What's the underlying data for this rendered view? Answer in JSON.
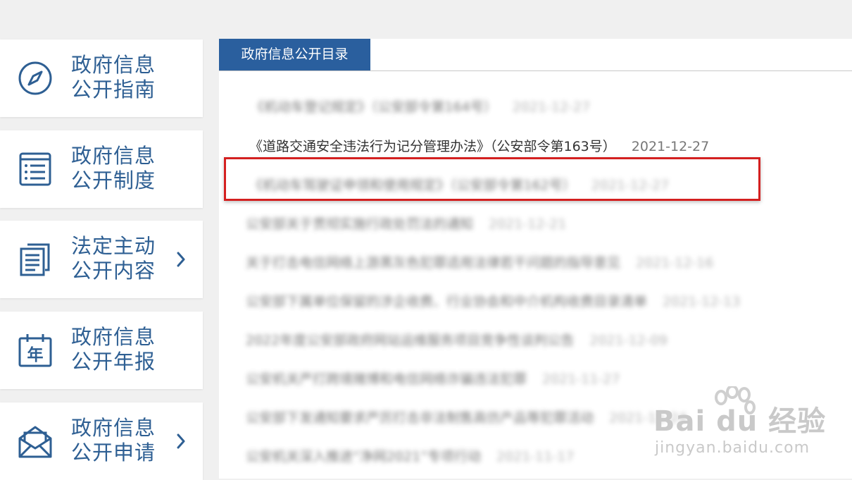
{
  "sidebar": {
    "items": [
      {
        "line1": "政府信息",
        "line2": "公开指南",
        "icon": "compass-icon",
        "has_arrow": false
      },
      {
        "line1": "政府信息",
        "line2": "公开制度",
        "icon": "list-document-icon",
        "has_arrow": false
      },
      {
        "line1": "法定主动",
        "line2": "公开内容",
        "icon": "documents-icon",
        "has_arrow": true
      },
      {
        "line1": "政府信息",
        "line2": "公开年报",
        "icon": "calendar-year-icon",
        "icon_text": "年",
        "has_arrow": false
      },
      {
        "line1": "政府信息",
        "line2": "公开申请",
        "icon": "envelope-icon",
        "has_arrow": true
      }
    ]
  },
  "main": {
    "tab_label": "政府信息公开目录",
    "items": [
      {
        "title": "《机动车登记规定》（公安部令第164号）",
        "date": "2021-12-27"
      },
      {
        "title": "《道路交通安全违法行为记分管理办法》（公安部令第163号）",
        "date": "2021-12-27"
      },
      {
        "title": "《机动车驾驶证申领和使用规定》（公安部令第162号）",
        "date": "2021-12-27"
      },
      {
        "title": "公安部关于贯彻实施行政处罚法的通知",
        "date": "2021-12-21"
      },
      {
        "title": "关于打击电信网络上游黑灰色犯罪适用法律若干问题的指导意见",
        "date": "2021-12-16"
      },
      {
        "title": "公安部下属单位保留的涉企收费、行业协会和中介机构收费目录清单",
        "date": "2021-12-13"
      },
      {
        "title": "2022年度公安部政府网站运维服务项目竞争性谈判公告",
        "date": "2021-12-09"
      },
      {
        "title": "公安机关严打跨境赌博和电信网络诈骗违法犯罪",
        "date": "2021-11-27"
      },
      {
        "title": "公安部下发通知要求严厉打击非法制售高仿产品等犯罪活动",
        "date": "2021-11-24"
      },
      {
        "title": "公安机关深入推进“净网2021”专项行动",
        "date": "2021-11-17"
      }
    ]
  },
  "watermark": {
    "brand": "Bai du 经验",
    "url": "jingyan.baidu.com"
  },
  "colors": {
    "accent": "#2a5f9e",
    "sidebar_text": "#2e5f93",
    "highlight": "#d42020"
  }
}
